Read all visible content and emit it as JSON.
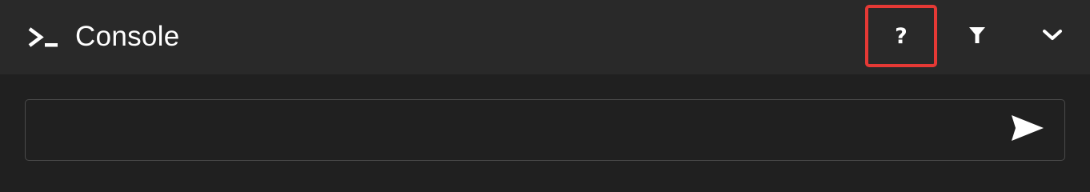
{
  "header": {
    "title": "Console",
    "icons": {
      "console": "terminal-prompt-icon",
      "help": "help-icon",
      "filter": "filter-icon",
      "collapse": "chevron-down-icon"
    },
    "help_glyph": "?"
  },
  "input": {
    "value": "",
    "placeholder": "",
    "send_icon": "send-icon"
  },
  "colors": {
    "header_bg": "#292929",
    "panel_bg": "#202020",
    "text": "#ffffff",
    "highlight_border": "#e53935",
    "input_border": "#4a4a4a"
  }
}
